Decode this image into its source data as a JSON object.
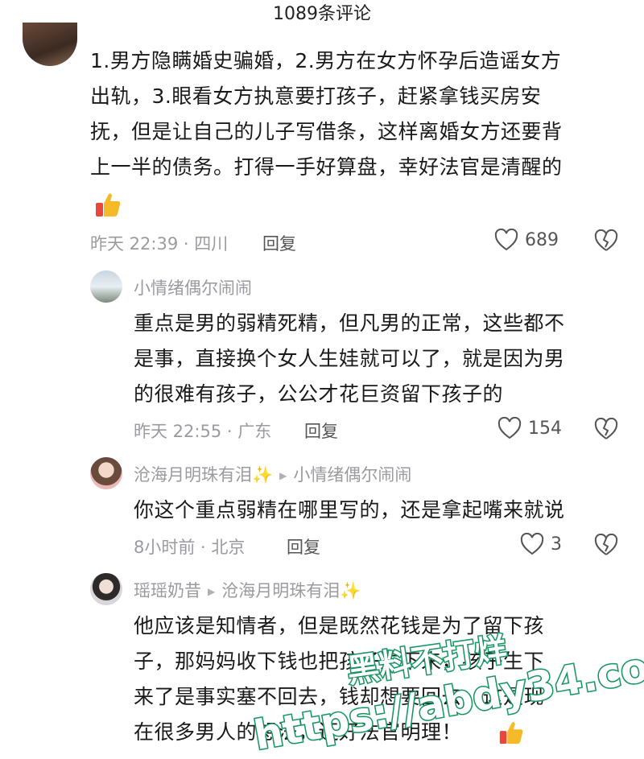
{
  "header": {
    "title": "1089条评论"
  },
  "comments": [
    {
      "text_lines": [
        "1.男方隐瞒婚史骗婚，2.男方在女方怀孕后造谣女方",
        "出轨，3.眼看女方执意要打孩子，赶紧拿钱买房安",
        "抚，但是让自己的儿子写借条，这样离婚女方还要背",
        "上一半的债务。打得一手好算盘，幸好法官是清醒的"
      ],
      "emoji": "thumbs-up-icon",
      "meta": "昨天 22:39 · 四川",
      "reply_label": "回复",
      "likes": "689"
    },
    {
      "username": "小情绪偶尔闹闹",
      "text_lines": [
        "重点是男的弱精死精，但凡男的正常，这些都不",
        "是事，直接换个女人生娃就可以了，就是因为男",
        "的很难有孩子，公公才花巨资留下孩子的"
      ],
      "meta": "昨天 22:55 · 广东",
      "reply_label": "回复",
      "likes": "154"
    },
    {
      "username": "沧海月明珠有泪✨",
      "reply_to": "小情绪偶尔闹闹",
      "text_lines": [
        "你这个重点弱精在哪里写的，还是拿起嘴来就说"
      ],
      "meta": "8小时前 · 北京",
      "reply_label": "回复",
      "likes": "3"
    },
    {
      "username": "瑶瑶奶昔",
      "reply_to": "沧海月明珠有泪✨",
      "text_lines": [
        "他应该是知情者，但是既然花钱是为了留下孩",
        "子，那妈妈收下钱也把孩子生下来，孩子生下",
        "来了是事实塞不回去，钱却想要回去，这是现",
        "在很多男人的想法，还好法官明理！"
      ],
      "emoji": "thumbs-up-icon"
    }
  ],
  "watermark": {
    "line1": "黑料不打烊",
    "line2": "https://abdy34.com"
  },
  "colors": {
    "meta": "#9a9aa0",
    "watermark_stroke": "#1aa36b",
    "sparkle": "#f5c13b"
  }
}
